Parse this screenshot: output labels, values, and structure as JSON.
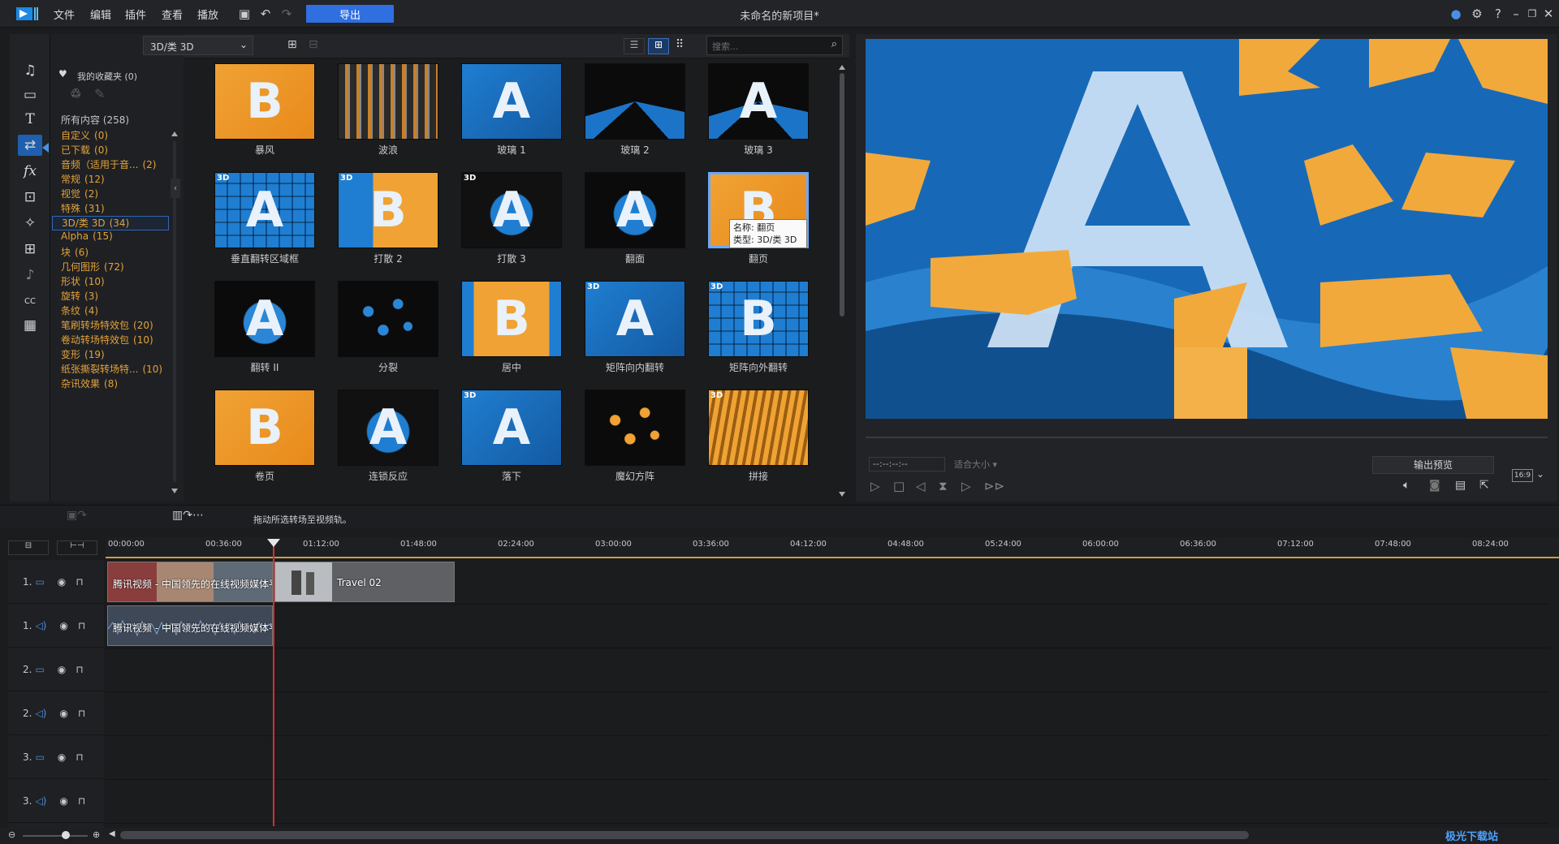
{
  "app": {
    "window_title": "未命名的新项目*",
    "menus": [
      "文件",
      "编辑",
      "插件",
      "查看",
      "播放"
    ],
    "export_label": "导出",
    "window_controls": [
      "notification-icon",
      "gear-icon",
      "help-icon",
      "minimize-icon",
      "restore-icon",
      "close-icon"
    ]
  },
  "library": {
    "filter_selected": "3D/类 3D",
    "search_placeholder": "搜索...",
    "favorites_label": "我的收藏夹 (0)",
    "all_content_label": "所有内容 (258)",
    "categories": [
      {
        "name": "自定义",
        "count": "(0)"
      },
      {
        "name": "已下载",
        "count": "(0)"
      },
      {
        "name": "音频（适用于音...",
        "count": "(2)"
      },
      {
        "name": "常规",
        "count": "(12)"
      },
      {
        "name": "视觉",
        "count": "(2)"
      },
      {
        "name": "特殊",
        "count": "(31)"
      },
      {
        "name": "3D/类 3D",
        "count": "(34)",
        "selected": true
      },
      {
        "name": "Alpha",
        "count": "(15)"
      },
      {
        "name": "块",
        "count": "(6)"
      },
      {
        "name": "几何图形",
        "count": "(72)"
      },
      {
        "name": "形状",
        "count": "(10)"
      },
      {
        "name": "旋转",
        "count": "(3)"
      },
      {
        "name": "条纹",
        "count": "(4)"
      },
      {
        "name": "笔刷转场特效包",
        "count": "(20)"
      },
      {
        "name": "卷动转场特效包",
        "count": "(10)"
      },
      {
        "name": "变形",
        "count": "(19)"
      },
      {
        "name": "纸张撕裂转场特...",
        "count": "(10)"
      },
      {
        "name": "杂讯效果",
        "count": "(8)"
      }
    ],
    "items": [
      {
        "label": "暴风",
        "letter": "B",
        "style": "orange",
        "is3d": false
      },
      {
        "label": "波浪",
        "letter": "",
        "style": "stripes",
        "is3d": false
      },
      {
        "label": "玻璃 1",
        "letter": "A",
        "style": "blue",
        "is3d": false
      },
      {
        "label": "玻璃 2",
        "letter": "",
        "style": "shatter",
        "is3d": false
      },
      {
        "label": "玻璃 3",
        "letter": "A",
        "style": "shatter",
        "is3d": false
      },
      {
        "label": "垂直翻转区域框",
        "letter": "A",
        "style": "grid",
        "is3d": true
      },
      {
        "label": "打散 2",
        "letter": "B",
        "style": "split",
        "is3d": true
      },
      {
        "label": "打散 3",
        "letter": "A",
        "style": "dark-blue",
        "is3d": true
      },
      {
        "label": "翻面",
        "letter": "A",
        "style": "flip",
        "is3d": false
      },
      {
        "label": "翻页",
        "letter": "B",
        "style": "orange",
        "is3d": false,
        "selected": true
      },
      {
        "label": "翻转 II",
        "letter": "A",
        "style": "tilt",
        "is3d": false
      },
      {
        "label": "分裂",
        "letter": "",
        "style": "scatter",
        "is3d": false
      },
      {
        "label": "居中",
        "letter": "B",
        "style": "hex",
        "is3d": false
      },
      {
        "label": "矩阵向内翻转",
        "letter": "A",
        "style": "blue",
        "is3d": true
      },
      {
        "label": "矩阵向外翻转",
        "letter": "B",
        "style": "grid",
        "is3d": true
      },
      {
        "label": "卷页",
        "letter": "B",
        "style": "orange",
        "is3d": false
      },
      {
        "label": "连锁反应",
        "letter": "A",
        "style": "dark-blue",
        "is3d": false
      },
      {
        "label": "落下",
        "letter": "A",
        "style": "blue",
        "is3d": true
      },
      {
        "label": "魔幻方阵",
        "letter": "",
        "style": "cubes",
        "is3d": false
      },
      {
        "label": "拼接",
        "letter": "",
        "style": "fold",
        "is3d": true
      }
    ],
    "tooltip": {
      "name_line": "名称: 翻页",
      "type_line": "类型: 3D/类 3D"
    }
  },
  "preview": {
    "timecode": "--:--:--:--",
    "fit_label": "适合大小",
    "output_preview_label": "输出预览",
    "aspect_label": "16:9"
  },
  "timeline": {
    "hint": "拖动所选转场至视频轨。",
    "ruler_ticks": [
      "00:00:00",
      "00:36:00",
      "01:12:00",
      "01:48:00",
      "02:24:00",
      "03:00:00",
      "03:36:00",
      "04:12:00",
      "04:48:00",
      "05:24:00",
      "06:00:00",
      "06:36:00",
      "07:12:00",
      "07:48:00",
      "08:24:00"
    ],
    "tracks": [
      {
        "label": "1.",
        "kind": "video"
      },
      {
        "label": "1.",
        "kind": "audio"
      },
      {
        "label": "2.",
        "kind": "video"
      },
      {
        "label": "2.",
        "kind": "audio"
      },
      {
        "label": "3.",
        "kind": "video"
      },
      {
        "label": "3.",
        "kind": "audio"
      }
    ],
    "clips": {
      "video1_a": "腾讯视频 - 中国领先的在线视频媒体平",
      "video1_b": "Travel 02",
      "audio1_a": "腾讯视频 - 中国领先的在线视频媒体平"
    }
  },
  "watermark": "极光下载站"
}
